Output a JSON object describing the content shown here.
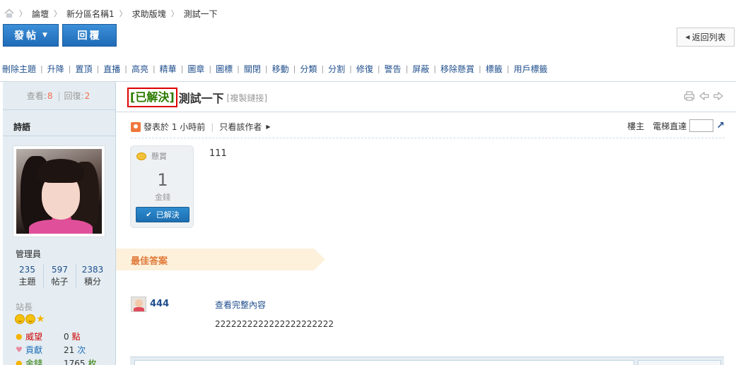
{
  "breadcrumb": {
    "items": [
      "論壇",
      "新分區名稱1",
      "求助版塊",
      "測試一下"
    ],
    "separator": "〉"
  },
  "toolbar": {
    "post_label": "發帖",
    "reply_label": "回覆",
    "back_label": "返回列表"
  },
  "mod_actions": [
    "刪除主題",
    "升降",
    "置頂",
    "直播",
    "高亮",
    "精華",
    "圖章",
    "圖標",
    "關閉",
    "移動",
    "分類",
    "分割",
    "修復",
    "警告",
    "屏蔽",
    "移除懸賞",
    "標籤",
    "用戶標籤"
  ],
  "thread": {
    "views_label": "查看:",
    "views": "8",
    "replies_label": "回復:",
    "replies": "2",
    "solved_tag": "[已解決]",
    "title": "測試一下",
    "copy_link": "[複製鏈接]"
  },
  "author": {
    "name": "詩語",
    "group": "管理員",
    "stats": [
      {
        "value": "235",
        "label": "主題"
      },
      {
        "value": "597",
        "label": "帖子"
      },
      {
        "value": "2383",
        "label": "積分"
      }
    ],
    "rank": "站長",
    "props": [
      {
        "label": "威望",
        "value": "0",
        "unit": "點",
        "label_color": "#cc0000",
        "unit_color": "#cc0000"
      },
      {
        "label": "貢獻",
        "value": "21",
        "unit": "次",
        "label_color": "#1f6fb8",
        "unit_color": "#1f6fb8"
      },
      {
        "label": "金錢",
        "value": "1765",
        "unit": "枚",
        "label_color": "#2b7a00",
        "unit_color": "#2b7a00"
      }
    ]
  },
  "post": {
    "posted_at": "發表於 1 小時前",
    "only_author": "只看該作者",
    "floor_label": "樓主",
    "elevator_label": "電梯直達",
    "content": "111"
  },
  "reward": {
    "label": "懸賞",
    "amount": "1",
    "unit": "金錢",
    "solved_button": "已解決"
  },
  "best_answer": {
    "heading": "最佳答案",
    "user": "444",
    "view_full": "查看完整內容",
    "text": "2222222222222222222222"
  },
  "colors": {
    "accent": "#1f6bb8",
    "link": "#1f4e8c",
    "solved_border": "#dd0000",
    "solved_text": "#2b7a00",
    "best_banner": "#fdf1dc"
  }
}
